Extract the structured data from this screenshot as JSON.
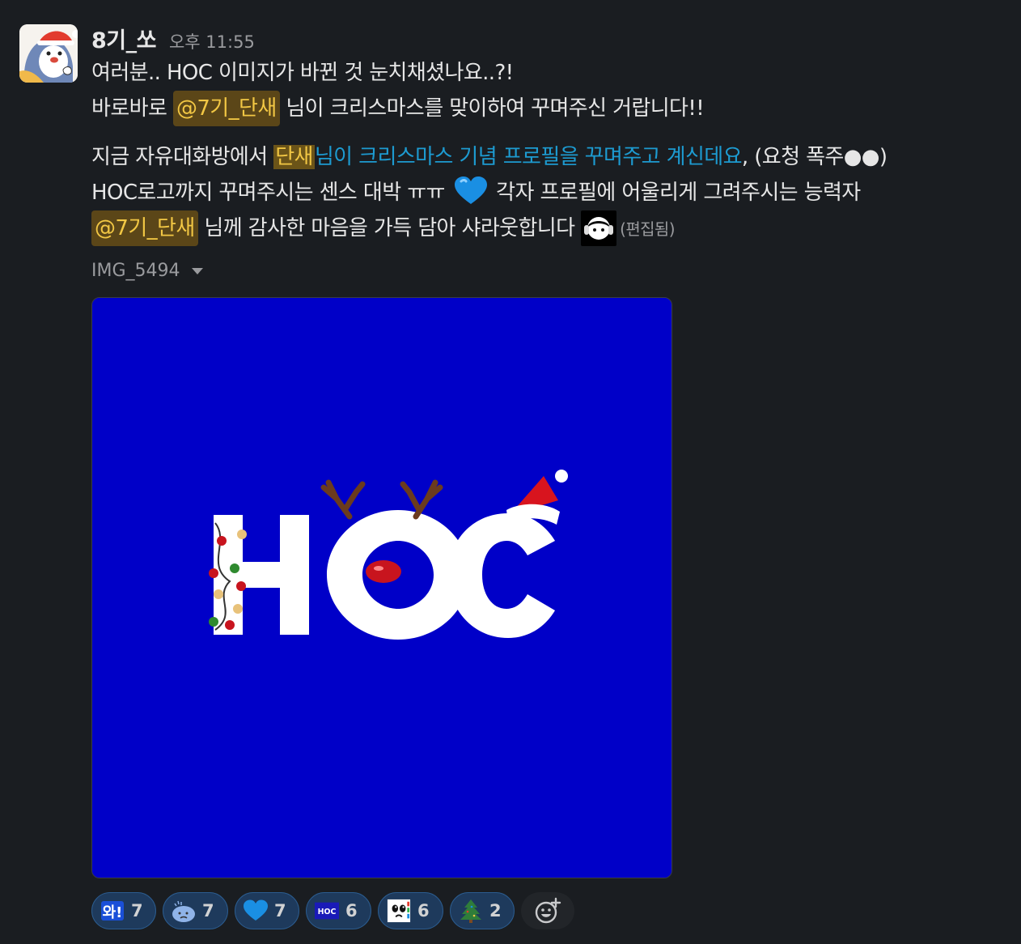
{
  "message": {
    "sender": "8기_쏘",
    "timestamp": "오후 11:55",
    "line1": "여러분.. HOC 이미지가 바뀐 것 눈치채셨나요..?!",
    "line2_prefix": "바로바로 ",
    "mention1": "@7기_단새",
    "line2_suffix": " 님이 크리스마스를 맞이하여 꾸며주신 거랍니다!!",
    "p2_prefix": "지금 자유대화방에서 ",
    "p2_highlight": "단새",
    "p2_link": "님이 크리스마스 기념 프로필을 꾸며주고 계신데요",
    "p2_after_link": ", (요청 폭주●●)",
    "p2_line2_a": "HOC로고까지 꾸며주시는 센스 대박 ㅠㅠ ",
    "p2_line2_b": " 각자 프로필에 어울리게 그려주시는 능력자",
    "mention2": "@7기_단새",
    "p2_line3": " 님께 감사한 마음을 가득 담아 샤라웃합니다 ",
    "edited": "(편집됨)"
  },
  "attachment": {
    "file_name": "IMG_5494",
    "image_text": "HOC",
    "bg_color": "#0000c8"
  },
  "reactions": [
    {
      "emoji": "wa-icon",
      "label": "와!",
      "count": "7"
    },
    {
      "emoji": "sad-blob-icon",
      "count": "7"
    },
    {
      "emoji": "blue-heart-icon",
      "count": "7"
    },
    {
      "emoji": "hoc-logo-icon",
      "label": "HOC",
      "count": "6"
    },
    {
      "emoji": "crying-face-icon",
      "count": "6"
    },
    {
      "emoji": "christmas-tree-icon",
      "count": "2"
    }
  ],
  "colors": {
    "background": "#1a1d21",
    "mention_bg": "#5b4618",
    "mention_fg": "#f2c744",
    "link": "#1d9bd1",
    "reaction_bg": "#1e3a5c",
    "reaction_border": "#2b5c8f"
  }
}
